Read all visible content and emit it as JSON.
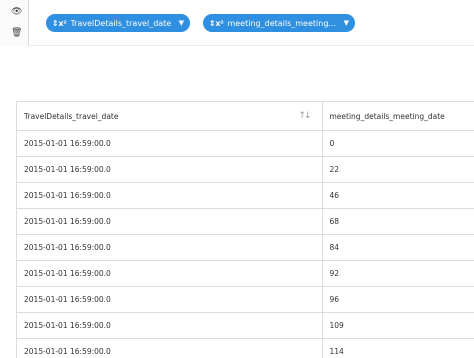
{
  "toolbar": {
    "chips": [
      {
        "label": "TravelDetails_travel_date",
        "icon": "sort-arrows-icon"
      },
      {
        "label": "meeting_details_meeting...",
        "icon": "sort-arrows-icon"
      }
    ]
  },
  "table": {
    "headers": [
      "TravelDetails_travel_date",
      "meeting_details_meeting_date"
    ],
    "rows": [
      [
        "2015-01-01 16:59:00.0",
        "0"
      ],
      [
        "2015-01-01 16:59:00.0",
        "22"
      ],
      [
        "2015-01-01 16:59:00.0",
        "46"
      ],
      [
        "2015-01-01 16:59:00.0",
        "68"
      ],
      [
        "2015-01-01 16:59:00.0",
        "84"
      ],
      [
        "2015-01-01 16:59:00.0",
        "92"
      ],
      [
        "2015-01-01 16:59:00.0",
        "96"
      ],
      [
        "2015-01-01 16:59:00.0",
        "109"
      ],
      [
        "2015-01-01 16:59:00.0",
        "114"
      ]
    ]
  },
  "colors": {
    "chip": "#2f8fe0",
    "border": "#dcdcdc"
  }
}
